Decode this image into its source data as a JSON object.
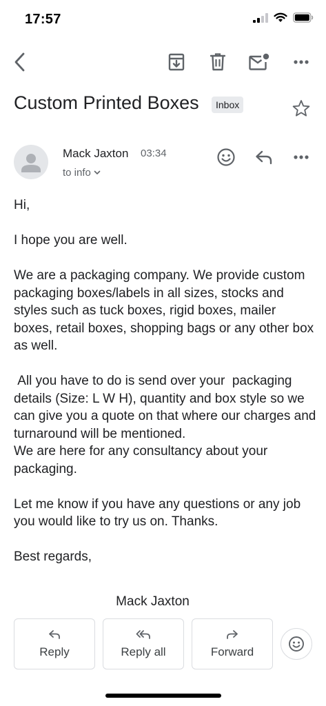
{
  "status_bar": {
    "time": "17:57"
  },
  "toolbar": {
    "back_icon": "chevron-left-icon",
    "archive_icon": "archive-icon",
    "delete_icon": "trash-icon",
    "mark_unread_icon": "mail-unread-icon",
    "more_icon": "more-horizontal-icon"
  },
  "email": {
    "subject": "Custom Printed Boxes",
    "label": "Inbox",
    "sender": {
      "name": "Mack Jaxton",
      "time": "03:34",
      "recipient": "to info"
    },
    "body": [
      "Hi,",
      "I hope you are well.",
      "We are a packaging company. We provide custom packaging boxes/labels in all sizes, stocks and  styles such as tuck boxes, rigid boxes, mailer boxes, retail boxes, shopping bags or any other box as well.",
      " All you have to do is send over your  packaging details (Size: L W H), quantity and box style so we can give you a quote on that where our charges and turnaround will be mentioned.",
      "We are here for any consultancy about your packaging.",
      "Let me know if you have any questions or any job you would like to try us on. Thanks.",
      "Best regards,"
    ],
    "signature": "Mack Jaxton"
  },
  "actions": {
    "reply": "Reply",
    "reply_all": "Reply all",
    "forward": "Forward"
  },
  "colors": {
    "text": "#202124",
    "secondary_text": "#5f6368",
    "icon": "#5f6368",
    "border": "#dadce0",
    "chip_bg": "#e8eaed"
  }
}
